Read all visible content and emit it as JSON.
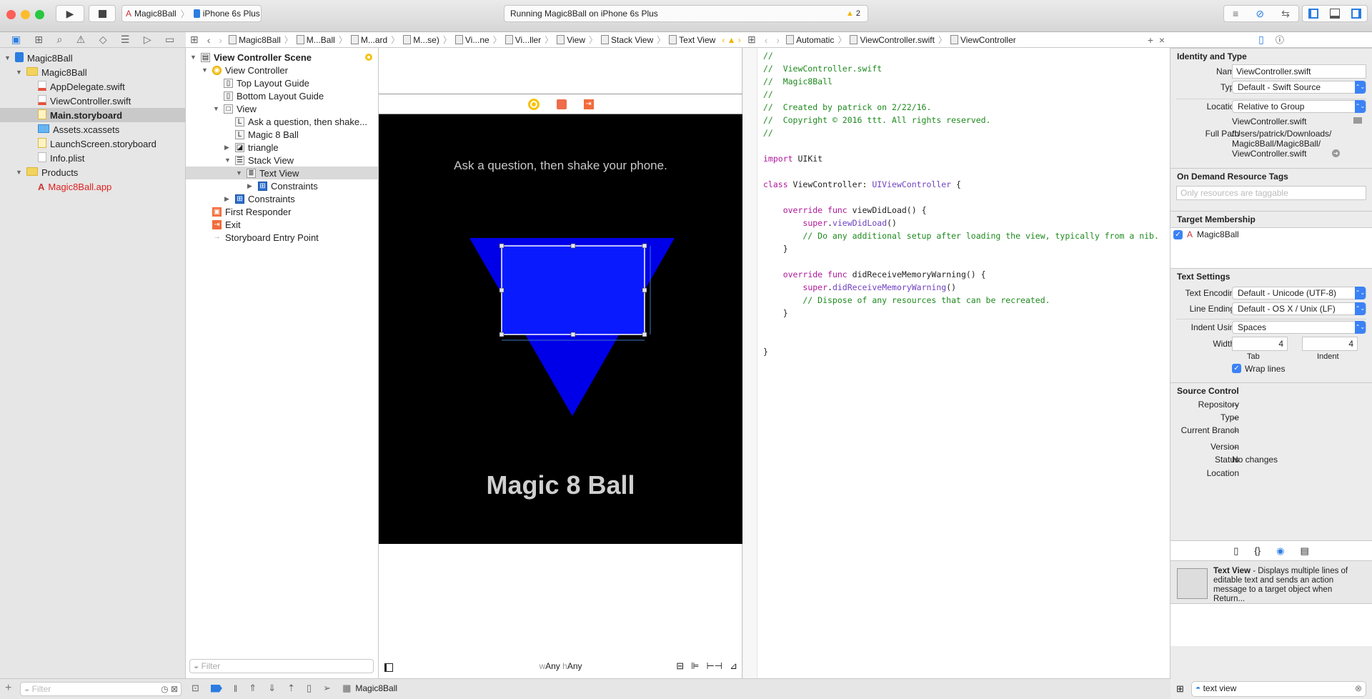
{
  "toolbar": {
    "scheme": "Magic8Ball",
    "device": "iPhone 6s Plus",
    "status": "Running Magic8Ball on iPhone 6s Plus",
    "warning_count": "2"
  },
  "jumpbar_left": [
    "Magic8Ball",
    "M...Ball",
    "M...ard",
    "M...se)",
    "Vi...ne",
    "Vi...ller",
    "View",
    "Stack View",
    "Text View"
  ],
  "jumpbar_right": [
    "Automatic",
    "ViewController.swift",
    "ViewController"
  ],
  "navigator": {
    "items": [
      {
        "label": "Magic8Ball",
        "kind": "project",
        "depth": 0,
        "open": true
      },
      {
        "label": "Magic8Ball",
        "kind": "folder",
        "depth": 1,
        "open": true
      },
      {
        "label": "AppDelegate.swift",
        "kind": "swift",
        "depth": 2
      },
      {
        "label": "ViewController.swift",
        "kind": "swift",
        "depth": 2
      },
      {
        "label": "Main.storyboard",
        "kind": "storyboard",
        "depth": 2,
        "selected": true
      },
      {
        "label": "Assets.xcassets",
        "kind": "assets",
        "depth": 2
      },
      {
        "label": "LaunchScreen.storyboard",
        "kind": "storyboard",
        "depth": 2
      },
      {
        "label": "Info.plist",
        "kind": "plist",
        "depth": 2
      },
      {
        "label": "Products",
        "kind": "folder",
        "depth": 1,
        "open": true
      },
      {
        "label": "Magic8Ball.app",
        "kind": "app",
        "depth": 2,
        "red": true
      }
    ],
    "filter_placeholder": "Filter"
  },
  "outline": {
    "items": [
      {
        "label": "View Controller Scene",
        "depth": 0,
        "tri": "▼",
        "icon": "scene",
        "bold": true
      },
      {
        "label": "View Controller",
        "depth": 1,
        "tri": "▼",
        "icon": "vc"
      },
      {
        "label": "Top Layout Guide",
        "depth": 2,
        "tri": "",
        "icon": "guide"
      },
      {
        "label": "Bottom Layout Guide",
        "depth": 2,
        "tri": "",
        "icon": "guide"
      },
      {
        "label": "View",
        "depth": 2,
        "tri": "▼",
        "icon": "view"
      },
      {
        "label": "Ask a question, then shake...",
        "depth": 3,
        "tri": "",
        "icon": "L"
      },
      {
        "label": "Magic 8 Ball",
        "depth": 3,
        "tri": "",
        "icon": "L"
      },
      {
        "label": "triangle",
        "depth": 3,
        "tri": "▶",
        "icon": "image"
      },
      {
        "label": "Stack View",
        "depth": 3,
        "tri": "▼",
        "icon": "stack"
      },
      {
        "label": "Text View",
        "depth": 4,
        "tri": "▼",
        "icon": "text",
        "selected": true
      },
      {
        "label": "Constraints",
        "depth": 5,
        "tri": "▶",
        "icon": "constraint"
      },
      {
        "label": "Constraints",
        "depth": 3,
        "tri": "▶",
        "icon": "constraint"
      },
      {
        "label": "First Responder",
        "depth": 1,
        "tri": "",
        "icon": "responder"
      },
      {
        "label": "Exit",
        "depth": 1,
        "tri": "",
        "icon": "exit"
      },
      {
        "label": "Storyboard Entry Point",
        "depth": 1,
        "tri": "",
        "icon": "arrow"
      }
    ],
    "filter_placeholder": "Filter"
  },
  "canvas": {
    "question_label": "Ask a question, then shake your phone.",
    "title_label": "Magic 8 Ball",
    "size_class_w": "w",
    "size_class_w_val": "Any",
    "size_class_h": "h",
    "size_class_h_val": "Any",
    "triangle_color": "#0000ff",
    "background": "#000000"
  },
  "code": {
    "lines": [
      [
        [
          "cm",
          "//"
        ]
      ],
      [
        [
          "cm",
          "//  ViewController.swift"
        ]
      ],
      [
        [
          "cm",
          "//  Magic8Ball"
        ]
      ],
      [
        [
          "cm",
          "//"
        ]
      ],
      [
        [
          "cm",
          "//  Created by patrick on 2/22/16."
        ]
      ],
      [
        [
          "cm",
          "//  Copyright © 2016 ttt. All rights reserved."
        ]
      ],
      [
        [
          "cm",
          "//"
        ]
      ],
      [],
      [
        [
          "kw",
          "import"
        ],
        [
          "fn",
          " UIKit"
        ]
      ],
      [],
      [
        [
          "kw",
          "class"
        ],
        [
          "fn",
          " ViewController: "
        ],
        [
          "ty",
          "UIViewController"
        ],
        [
          "fn",
          " {"
        ]
      ],
      [],
      [
        [
          "fn",
          "    "
        ],
        [
          "kw",
          "override func"
        ],
        [
          "fn",
          " viewDidLoad() {"
        ]
      ],
      [
        [
          "fn",
          "        "
        ],
        [
          "kw",
          "super"
        ],
        [
          "fn",
          "."
        ],
        [
          "ty",
          "viewDidLoad"
        ],
        [
          "fn",
          "()"
        ]
      ],
      [
        [
          "cm",
          "        // Do any additional setup after loading the view, typically from a nib."
        ]
      ],
      [
        [
          "fn",
          "    }"
        ]
      ],
      [],
      [
        [
          "fn",
          "    "
        ],
        [
          "kw",
          "override func"
        ],
        [
          "fn",
          " didReceiveMemoryWarning() {"
        ]
      ],
      [
        [
          "fn",
          "        "
        ],
        [
          "kw",
          "super"
        ],
        [
          "fn",
          "."
        ],
        [
          "ty",
          "didReceiveMemoryWarning"
        ],
        [
          "fn",
          "()"
        ]
      ],
      [
        [
          "cm",
          "        // Dispose of any resources that can be recreated."
        ]
      ],
      [
        [
          "fn",
          "    }"
        ]
      ],
      [],
      [],
      [
        [
          "fn",
          "}"
        ]
      ]
    ]
  },
  "inspector": {
    "identity": {
      "title": "Identity and Type",
      "name_label": "Name",
      "name": "ViewController.swift",
      "type_label": "Type",
      "type": "Default - Swift Source",
      "location_label": "Location",
      "location": "Relative to Group",
      "filename": "ViewController.swift",
      "fullpath_label": "Full Path",
      "fullpath": [
        "/Users/patrick/Downloads/",
        "Magic8Ball/Magic8Ball/",
        "ViewController.swift"
      ]
    },
    "odr": {
      "title": "On Demand Resource Tags",
      "placeholder": "Only resources are taggable"
    },
    "target": {
      "title": "Target Membership",
      "item": "Magic8Ball",
      "checked": true
    },
    "text": {
      "title": "Text Settings",
      "enc_label": "Text Encoding",
      "enc": "Default - Unicode (UTF-8)",
      "le_label": "Line Endings",
      "le": "Default - OS X / Unix (LF)",
      "indent_label": "Indent Using",
      "indent": "Spaces",
      "widths_label": "Widths",
      "tab": "4",
      "indent_w": "4",
      "tab_label": "Tab",
      "indent_w_label": "Indent",
      "wrap": "Wrap lines",
      "wrap_checked": true
    },
    "source": {
      "title": "Source Control",
      "rows": [
        [
          "Repository",
          "--"
        ],
        [
          "Type",
          "--"
        ],
        [
          "Current Branch",
          "--"
        ],
        [
          "Version",
          "--"
        ],
        [
          "Status",
          "No changes"
        ],
        [
          "Location",
          ""
        ]
      ]
    }
  },
  "library": {
    "item_title": "Text View",
    "item_desc": " - Displays multiple lines of editable text and sends an action message to a target object when Return...",
    "search": "text view"
  },
  "debugbar": {
    "target": "Magic8Ball"
  }
}
